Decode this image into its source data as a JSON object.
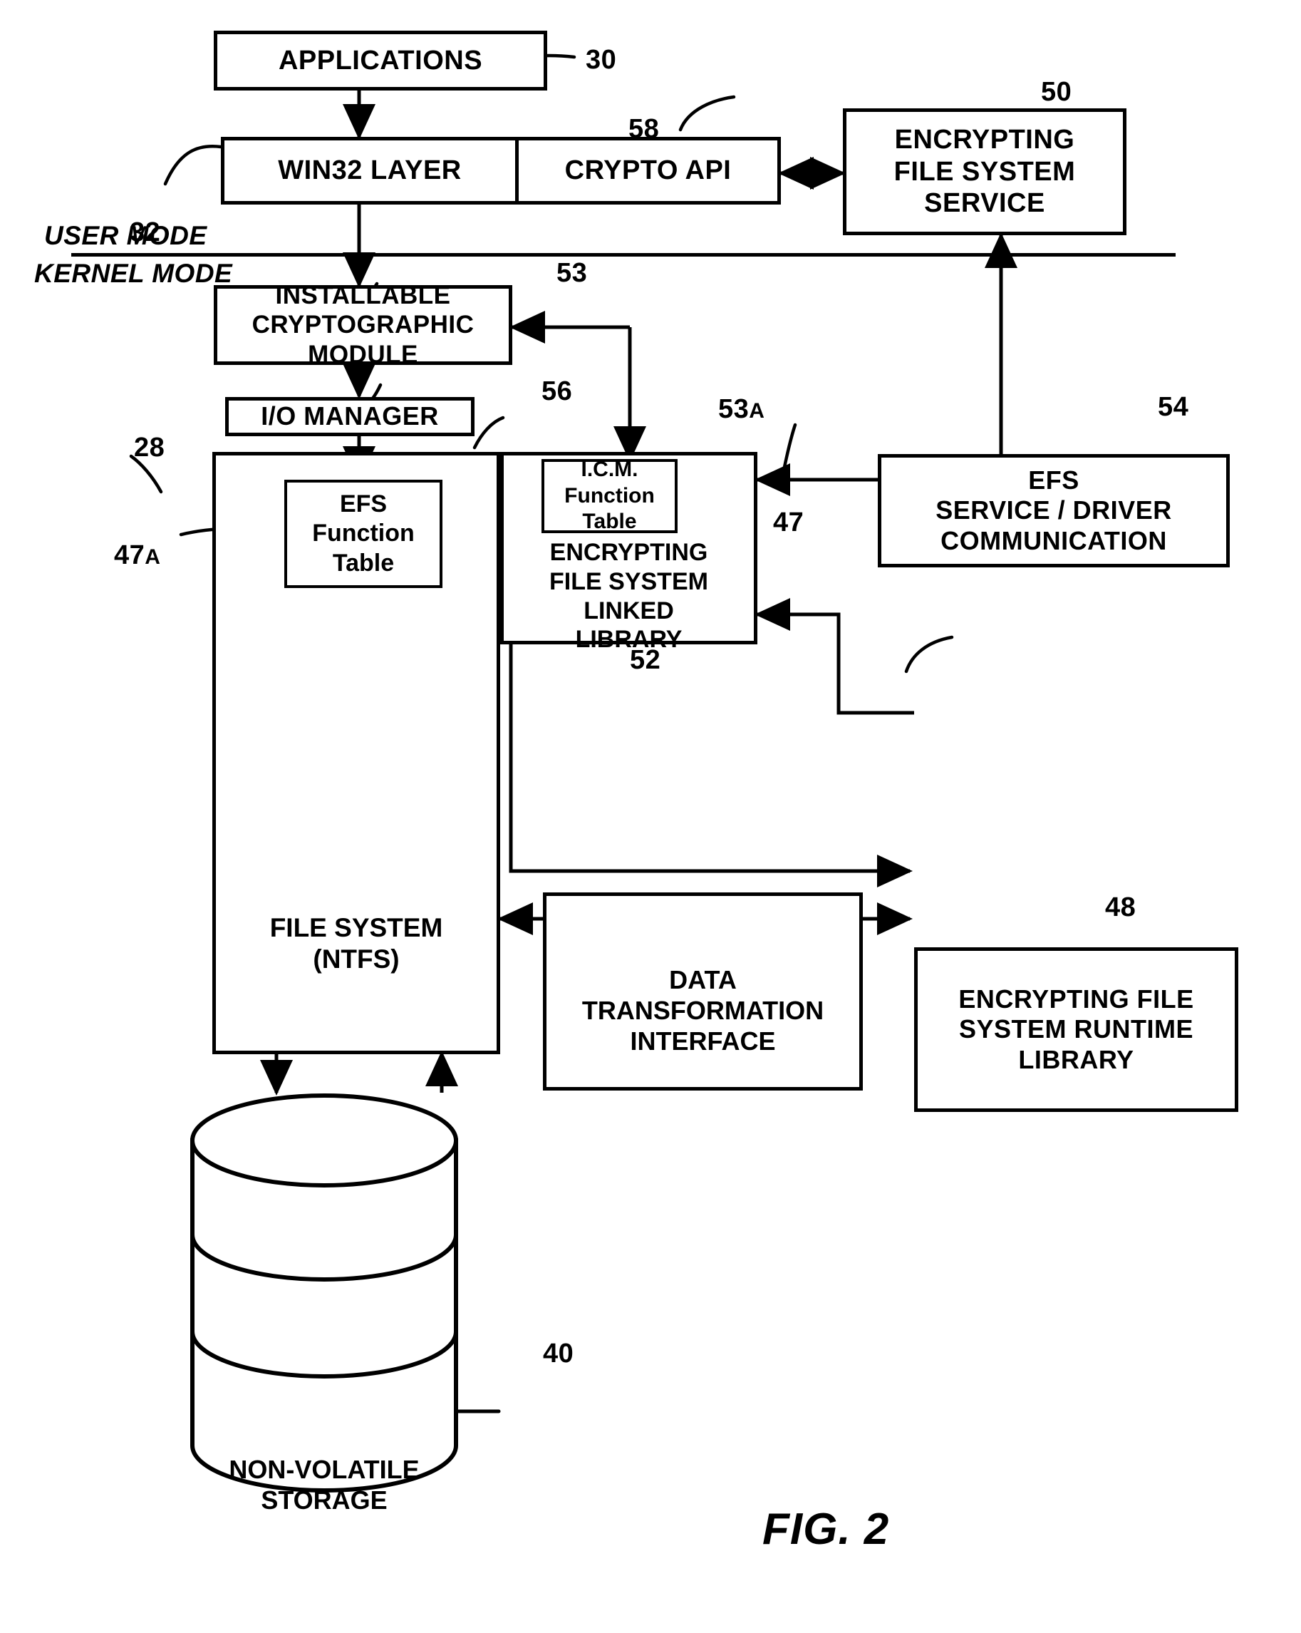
{
  "figure": {
    "label": "FIG. 2",
    "mode_labels": {
      "user": "USER MODE",
      "kernel": "KERNEL MODE"
    }
  },
  "boxes": {
    "applications": {
      "label": "APPLICATIONS",
      "ref": "30"
    },
    "win32_layer": {
      "label": "WIN32 LAYER",
      "ref": "32"
    },
    "crypto_api": {
      "label": "CRYPTO API",
      "ref": "58"
    },
    "efs_service": {
      "label": "ENCRYPTING\nFILE SYSTEM\nSERVICE",
      "ref": "50"
    },
    "installable_crypto_module": {
      "label": "INSTALLABLE\nCRYPTOGRAPHIC\nMODULE",
      "ref": "53"
    },
    "io_manager": {
      "label": "I/O MANAGER",
      "ref": "56"
    },
    "file_system": {
      "label": "FILE SYSTEM\n(NTFS)",
      "ref": "28"
    },
    "efs_function_table": {
      "label": "EFS\nFunction\nTable",
      "ref": "47A"
    },
    "efs_linked_library": {
      "label": "ENCRYPTING\nFILE SYSTEM\nLINKED\nLIBRARY",
      "ref": "47"
    },
    "icm_function_table": {
      "label": "I.C.M.\nFunction\nTable",
      "ref": "53A"
    },
    "efs_service_driver_comm": {
      "label": "EFS\nSERVICE / DRIVER\nCOMMUNICATION",
      "ref": "54"
    },
    "efs_runtime_library": {
      "label": "ENCRYPTING FILE\nSYSTEM RUNTIME\nLIBRARY",
      "ref": "48"
    },
    "data_transformation_interface": {
      "label": "DATA\nTRANSFORMATION\nINTERFACE",
      "ref": "52"
    },
    "nonvolatile_storage": {
      "label": "NON-VOLATILE\nSTORAGE",
      "ref": "40"
    }
  },
  "ref_numbers": {
    "n30": "30",
    "n32": "32",
    "n58": "58",
    "n50": "50",
    "n53": "53",
    "n53a_num": "53",
    "n53a_sub": "A",
    "n56": "56",
    "n54": "54",
    "n28": "28",
    "n47": "47",
    "n47a_num": "47",
    "n47a_sub": "A",
    "n48": "48",
    "n52": "52",
    "n40": "40"
  },
  "colors": {
    "stroke": "#000000",
    "background": "#ffffff"
  }
}
